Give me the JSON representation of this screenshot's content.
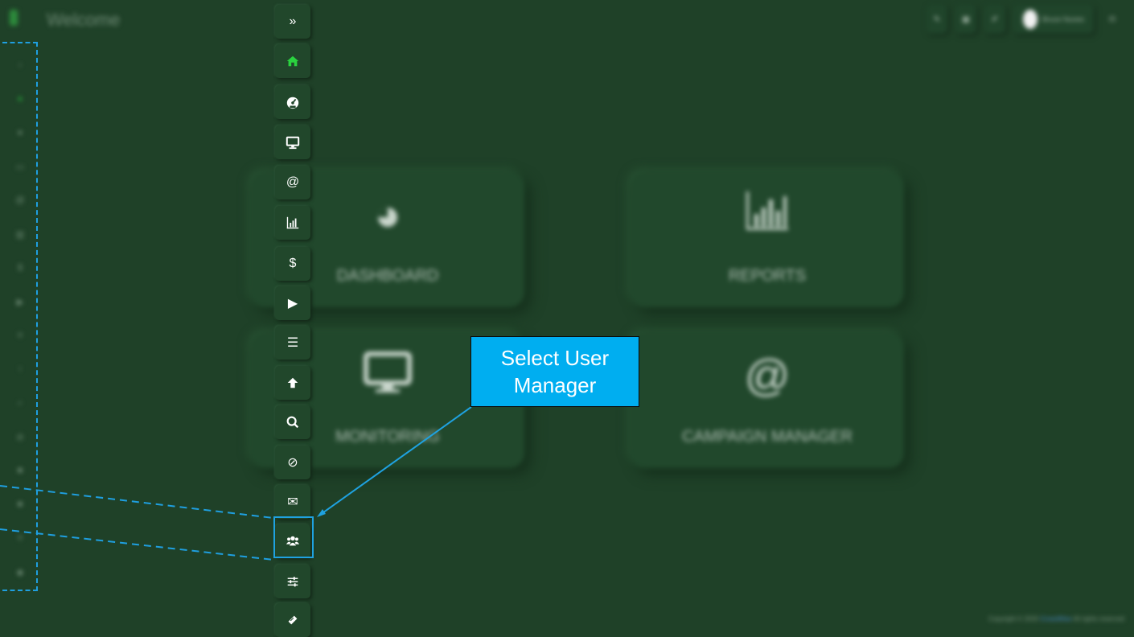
{
  "app": {
    "welcome": "Welcome"
  },
  "topbar": {
    "user_name": "Bruce Nunes"
  },
  "cards": [
    {
      "label": "DASHBOARD",
      "icon": "dashboard-icon"
    },
    {
      "label": "REPORTS",
      "icon": "reports-chart-icon"
    },
    {
      "label": "MONITORING",
      "icon": "monitor-icon"
    },
    {
      "label": "CAMPAIGN MANAGER",
      "icon": "at-sign-icon"
    }
  ],
  "sidebar": {
    "items": [
      {
        "name": "expand",
        "icon": "double-chevron-right-icon",
        "glyph": "»"
      },
      {
        "name": "home",
        "icon": "home-icon",
        "glyph": ""
      },
      {
        "name": "dashboard",
        "icon": "gauge-icon",
        "glyph": ""
      },
      {
        "name": "monitoring",
        "icon": "desktop-icon",
        "glyph": ""
      },
      {
        "name": "campaign",
        "icon": "at-icon",
        "glyph": "@"
      },
      {
        "name": "reports",
        "icon": "bar-chart-icon",
        "glyph": ""
      },
      {
        "name": "billing",
        "icon": "dollar-icon",
        "glyph": "$"
      },
      {
        "name": "play",
        "icon": "play-icon",
        "glyph": "▶"
      },
      {
        "name": "list",
        "icon": "list-icon",
        "glyph": "☰"
      },
      {
        "name": "upload",
        "icon": "arrow-up-icon",
        "glyph": ""
      },
      {
        "name": "search",
        "icon": "search-icon",
        "glyph": ""
      },
      {
        "name": "block",
        "icon": "block-icon",
        "glyph": "⊘"
      },
      {
        "name": "mail",
        "icon": "envelope-icon",
        "glyph": "✉"
      },
      {
        "name": "user-manager",
        "icon": "users-icon",
        "glyph": ""
      },
      {
        "name": "settings",
        "icon": "sliders-icon",
        "glyph": ""
      },
      {
        "name": "ticket",
        "icon": "ticket-icon",
        "glyph": ""
      }
    ]
  },
  "callout": {
    "text": "Select User Manager"
  },
  "footer": {
    "prefix": "Copyright © 2020",
    "link": "CrossWise",
    "suffix": "All rights reserved"
  },
  "colors": {
    "background": "#1f4128",
    "accent": "#00aef0",
    "active_icon": "#2ad23f"
  }
}
